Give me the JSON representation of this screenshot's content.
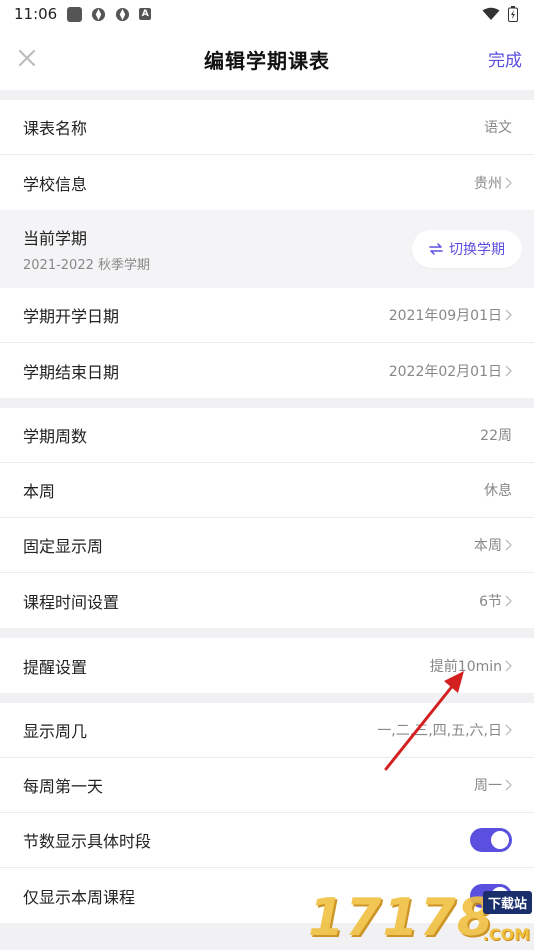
{
  "status_bar": {
    "time": "11:06"
  },
  "header": {
    "title": "编辑学期课表",
    "done_label": "完成"
  },
  "group1": {
    "schedule_name": {
      "label": "课表名称",
      "value": "语文"
    },
    "school_info": {
      "label": "学校信息",
      "value": "贵州"
    }
  },
  "semester": {
    "label": "当前学期",
    "sub": "2021-2022 秋季学期",
    "switch_label": "切换学期"
  },
  "group2": {
    "start_date": {
      "label": "学期开学日期",
      "value": "2021年09月01日"
    },
    "end_date": {
      "label": "学期结束日期",
      "value": "2022年02月01日"
    }
  },
  "group3": {
    "weeks": {
      "label": "学期周数",
      "value": "22周"
    },
    "this_week": {
      "label": "本周",
      "value": "休息"
    },
    "fixed_week": {
      "label": "固定显示周",
      "value": "本周"
    },
    "class_time": {
      "label": "课程时间设置",
      "value": "6节"
    }
  },
  "group4": {
    "reminder": {
      "label": "提醒设置",
      "value": "提前10min"
    }
  },
  "group5": {
    "show_days": {
      "label": "显示周几",
      "value": "一,二,三,四,五,六,日"
    },
    "first_day": {
      "label": "每周第一天",
      "value": "周一"
    },
    "show_period_time": {
      "label": "节数显示具体时段",
      "enabled": true
    },
    "only_this_week": {
      "label": "仅显示本周课程",
      "enabled": true
    }
  },
  "watermark": {
    "digits": "17178",
    "badge": "下载站",
    "domain": ".COM"
  },
  "colors": {
    "accent": "#5b4fe0",
    "annotation_arrow": "#d42020"
  }
}
